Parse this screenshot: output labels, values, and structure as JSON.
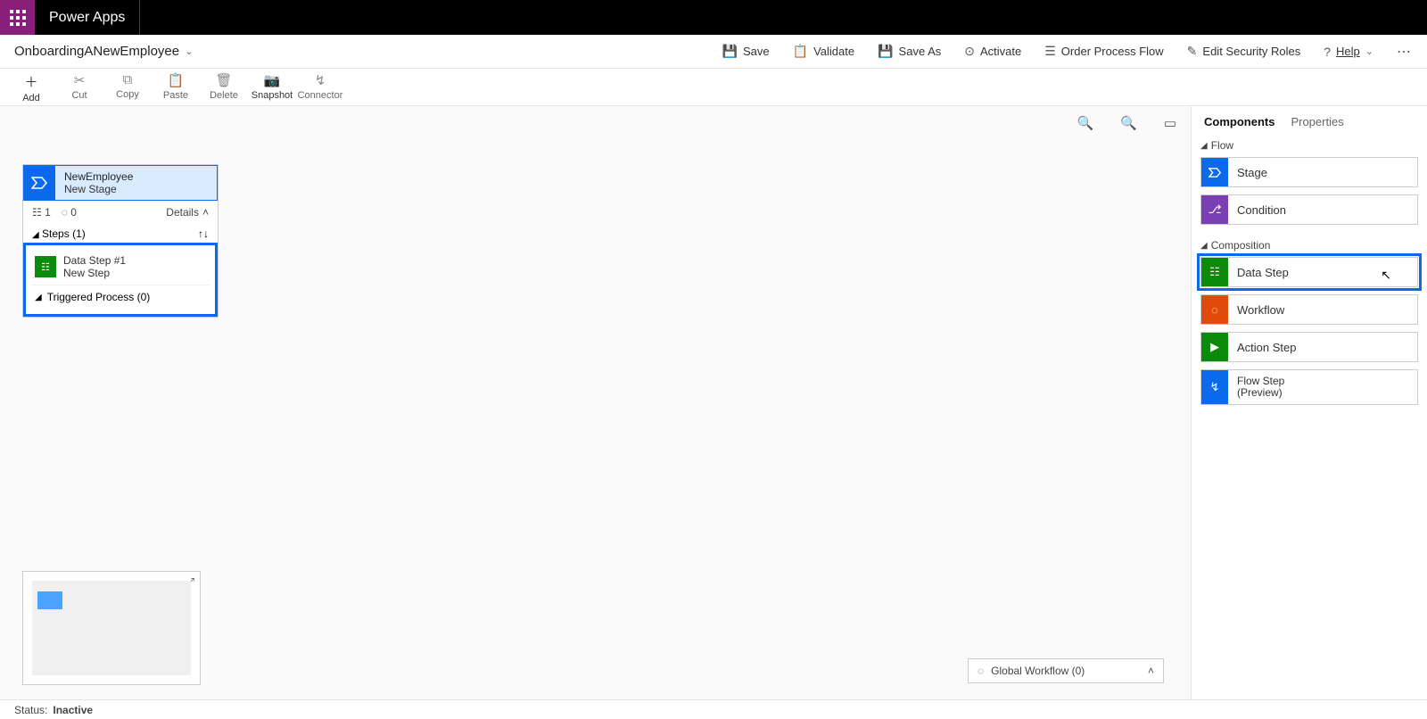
{
  "appTitle": "Power Apps",
  "fileName": "OnboardingANewEmployee",
  "commands": {
    "save": "Save",
    "validate": "Validate",
    "saveAs": "Save As",
    "activate": "Activate",
    "orderFlow": "Order Process Flow",
    "editSecurity": "Edit Security Roles",
    "help": "Help"
  },
  "tools": {
    "add": "Add",
    "cut": "Cut",
    "copy": "Copy",
    "paste": "Paste",
    "delete": "Delete",
    "snapshot": "Snapshot",
    "connector": "Connector"
  },
  "stage": {
    "name": "NewEmployee",
    "subtitle": "New Stage",
    "stepCountIcon": "1",
    "workflowCount": "0",
    "detailsLabel": "Details",
    "stepsLabel": "Steps (1)",
    "dataStepName": "Data Step #1",
    "dataStepSub": "New Step",
    "triggered": "Triggered Process (0)"
  },
  "globalWorkflow": "Global Workflow (0)",
  "rightPanel": {
    "tabComponents": "Components",
    "tabProperties": "Properties",
    "sectionFlow": "Flow",
    "sectionComposition": "Composition",
    "items": {
      "stage": "Stage",
      "condition": "Condition",
      "dataStep": "Data Step",
      "workflow": "Workflow",
      "actionStep": "Action Step",
      "flowStep": "Flow Step\n(Preview)"
    }
  },
  "status": {
    "label": "Status:",
    "value": "Inactive"
  }
}
